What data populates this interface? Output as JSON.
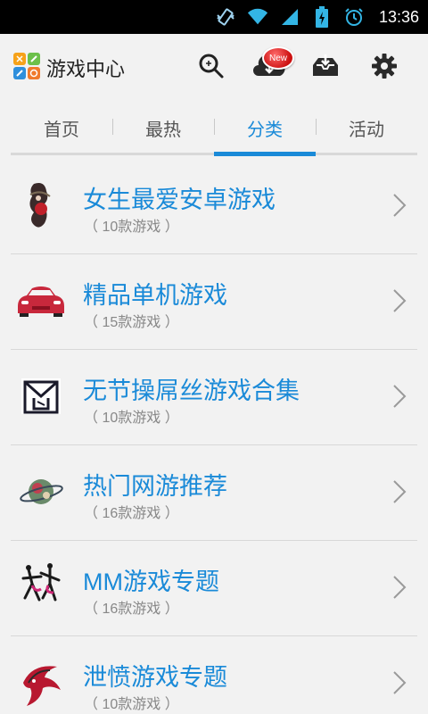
{
  "status_bar": {
    "time": "13:36",
    "icons": [
      "vibrate-icon",
      "wifi-icon",
      "signal-icon",
      "battery-icon",
      "alarm-icon"
    ]
  },
  "header": {
    "title": "游戏中心",
    "badge": "New",
    "icons": [
      "search-icon",
      "cloud-download-icon",
      "download-tray-icon",
      "gear-icon"
    ]
  },
  "tabs": [
    {
      "label": "首页",
      "active": false
    },
    {
      "label": "最热",
      "active": false
    },
    {
      "label": "分类",
      "active": true
    },
    {
      "label": "活动",
      "active": false
    }
  ],
  "categories": [
    {
      "title": "女生最爱安卓游戏",
      "count": "（ 10款游戏 ）",
      "icon": "girl-figure-icon"
    },
    {
      "title": "精品单机游戏",
      "count": "（ 15款游戏 ）",
      "icon": "red-car-icon"
    },
    {
      "title": "无节操屌丝游戏合集",
      "count": "（ 10款游戏 ）",
      "icon": "character-glyph-icon"
    },
    {
      "title": "热门网游推荐",
      "count": "（ 16款游戏 ）",
      "icon": "planet-ring-icon"
    },
    {
      "title": "MM游戏专题",
      "count": "（ 16款游戏 ）",
      "icon": "dancers-icon"
    },
    {
      "title": "泄愤游戏专题",
      "count": "（ 10款游戏 ）",
      "icon": "flame-bird-icon"
    }
  ],
  "colors": {
    "accent": "#1a8ad8",
    "background": "#f2f2f2",
    "status_bar": "#000000",
    "badge": "#cc1111"
  }
}
